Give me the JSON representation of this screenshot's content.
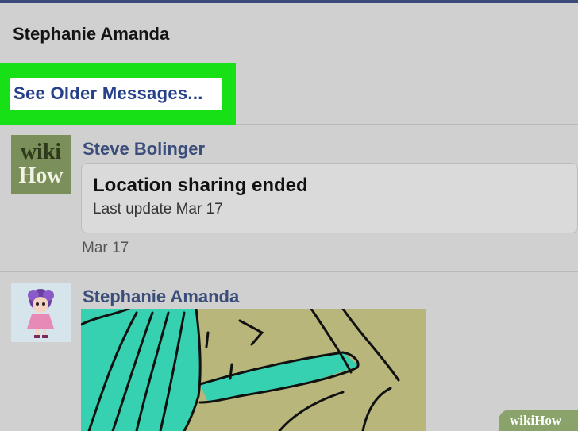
{
  "conversation": {
    "title": "Stephanie Amanda"
  },
  "older_messages": {
    "label": "See Older Messages..."
  },
  "messages": [
    {
      "sender": "Steve Bolinger",
      "avatar_text_top": "wiki",
      "avatar_text_bottom": "How",
      "card_title": "Location sharing ended",
      "card_subtitle": "Last update Mar 17",
      "date": "Mar 17"
    },
    {
      "sender": "Stephanie Amanda",
      "attachment": "drawing-image"
    }
  ],
  "watermark": {
    "part1": "wiki",
    "part2": "How"
  },
  "colors": {
    "highlight": "#17e017",
    "link": "#27408a",
    "sender": "#3b4d7a",
    "drawing_teal": "#36d1b0",
    "drawing_khaki": "#b8b67a"
  }
}
